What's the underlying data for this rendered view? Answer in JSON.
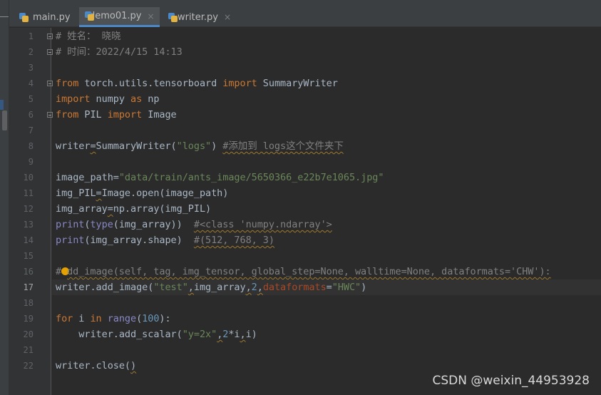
{
  "tabs": [
    {
      "label": "main.py",
      "active": false,
      "close": ""
    },
    {
      "label": "demo01.py",
      "active": true,
      "close": "×"
    },
    {
      "label": "writer.py",
      "active": false,
      "close": "×"
    }
  ],
  "editor": {
    "current_line": 17,
    "lines": [
      {
        "n": "1",
        "segs": [
          {
            "t": "# 姓名： 晓晓",
            "c": "cm"
          }
        ],
        "fold": true
      },
      {
        "n": "2",
        "segs": [
          {
            "t": "# 时间：2022/4/15 14:13",
            "c": "cm"
          }
        ],
        "fold": true
      },
      {
        "n": "3",
        "segs": []
      },
      {
        "n": "4",
        "segs": [
          {
            "t": "from",
            "c": "kw"
          },
          {
            "t": " torch.utils.tensorboard ",
            "c": ""
          },
          {
            "t": "import",
            "c": "kw"
          },
          {
            "t": " SummaryWriter",
            "c": ""
          }
        ],
        "fold": true
      },
      {
        "n": "5",
        "segs": [
          {
            "t": "import",
            "c": "kw"
          },
          {
            "t": " numpy ",
            "c": ""
          },
          {
            "t": "as",
            "c": "kw"
          },
          {
            "t": " np",
            "c": ""
          }
        ]
      },
      {
        "n": "6",
        "segs": [
          {
            "t": "from",
            "c": "kw"
          },
          {
            "t": " PIL ",
            "c": ""
          },
          {
            "t": "import",
            "c": "kw"
          },
          {
            "t": " Image",
            "c": ""
          }
        ],
        "fold": true
      },
      {
        "n": "7",
        "segs": []
      },
      {
        "n": "8",
        "segs": [
          {
            "t": "writer",
            "c": ""
          },
          {
            "t": "=",
            "c": "sq"
          },
          {
            "t": "SummaryWriter(",
            "c": ""
          },
          {
            "t": "\"logs\"",
            "c": "str"
          },
          {
            "t": ") ",
            "c": ""
          },
          {
            "t": "#添加到 logs这个文件夹下",
            "c": "cm sq"
          }
        ]
      },
      {
        "n": "9",
        "segs": []
      },
      {
        "n": "10",
        "segs": [
          {
            "t": "image_path",
            "c": ""
          },
          {
            "t": "=",
            "c": ""
          },
          {
            "t": "\"data/train/ants_image/5650366_e22b7e1065.jpg\"",
            "c": "str"
          }
        ]
      },
      {
        "n": "11",
        "segs": [
          {
            "t": "img_PIL",
            "c": ""
          },
          {
            "t": "=",
            "c": "sq"
          },
          {
            "t": "Image.open(image_path)",
            "c": ""
          }
        ]
      },
      {
        "n": "12",
        "segs": [
          {
            "t": "img_array",
            "c": ""
          },
          {
            "t": "=",
            "c": "sq"
          },
          {
            "t": "np.array(img_PIL)",
            "c": ""
          }
        ]
      },
      {
        "n": "13",
        "segs": [
          {
            "t": "print",
            "c": "bi"
          },
          {
            "t": "(",
            "c": ""
          },
          {
            "t": "type",
            "c": "bi"
          },
          {
            "t": "(img_array))  ",
            "c": ""
          },
          {
            "t": "#<class 'numpy.ndarray'>",
            "c": "cm sq"
          }
        ]
      },
      {
        "n": "14",
        "segs": [
          {
            "t": "print",
            "c": "bi"
          },
          {
            "t": "(img_array.shape)  ",
            "c": ""
          },
          {
            "t": "#(512, 768, 3)",
            "c": "cm sq"
          }
        ]
      },
      {
        "n": "15",
        "segs": []
      },
      {
        "n": "16",
        "segs": [
          {
            "t": "#",
            "c": "cm"
          },
          {
            "t": "",
            "c": "bulb"
          },
          {
            "t": "dd_image(self, tag, img_tensor, global_step=None, walltime=None, dataformats='CHW'):",
            "c": "cm sq"
          }
        ]
      },
      {
        "n": "17",
        "segs": [
          {
            "t": "writer.add_image(",
            "c": ""
          },
          {
            "t": "\"test\"",
            "c": "str"
          },
          {
            "t": ",",
            "c": "sq"
          },
          {
            "t": "img_array",
            "c": ""
          },
          {
            "t": ",",
            "c": "sq"
          },
          {
            "t": "2",
            "c": "num"
          },
          {
            "t": ",",
            "c": "sq"
          },
          {
            "t": "dataformats",
            "c": "param"
          },
          {
            "t": "=",
            "c": ""
          },
          {
            "t": "\"HWC\"",
            "c": "str"
          },
          {
            "t": ")",
            "c": ""
          }
        ]
      },
      {
        "n": "18",
        "segs": []
      },
      {
        "n": "19",
        "segs": [
          {
            "t": "for",
            "c": "kw"
          },
          {
            "t": " i ",
            "c": ""
          },
          {
            "t": "in",
            "c": "kw"
          },
          {
            "t": " ",
            "c": ""
          },
          {
            "t": "range",
            "c": "bi"
          },
          {
            "t": "(",
            "c": ""
          },
          {
            "t": "100",
            "c": "num"
          },
          {
            "t": "):",
            "c": ""
          }
        ]
      },
      {
        "n": "20",
        "segs": [
          {
            "t": "    writer.add_scalar(",
            "c": ""
          },
          {
            "t": "\"y=2x\"",
            "c": "str"
          },
          {
            "t": ",",
            "c": "sq"
          },
          {
            "t": "2",
            "c": "num"
          },
          {
            "t": "*i",
            "c": ""
          },
          {
            "t": ",",
            "c": "sq"
          },
          {
            "t": "i)",
            "c": ""
          }
        ]
      },
      {
        "n": "21",
        "segs": []
      },
      {
        "n": "22",
        "segs": [
          {
            "t": "writer.close(",
            "c": ""
          },
          {
            "t": ")",
            "c": "sq"
          }
        ]
      }
    ]
  },
  "watermark": "CSDN @weixin_44953928",
  "colors": {
    "background": "#2b2b2b",
    "keyword": "#cc7832",
    "string": "#6a8759",
    "comment": "#808080",
    "number": "#6897bb",
    "builtin": "#8888c6",
    "active_tab_underline": "#4a88c7"
  }
}
